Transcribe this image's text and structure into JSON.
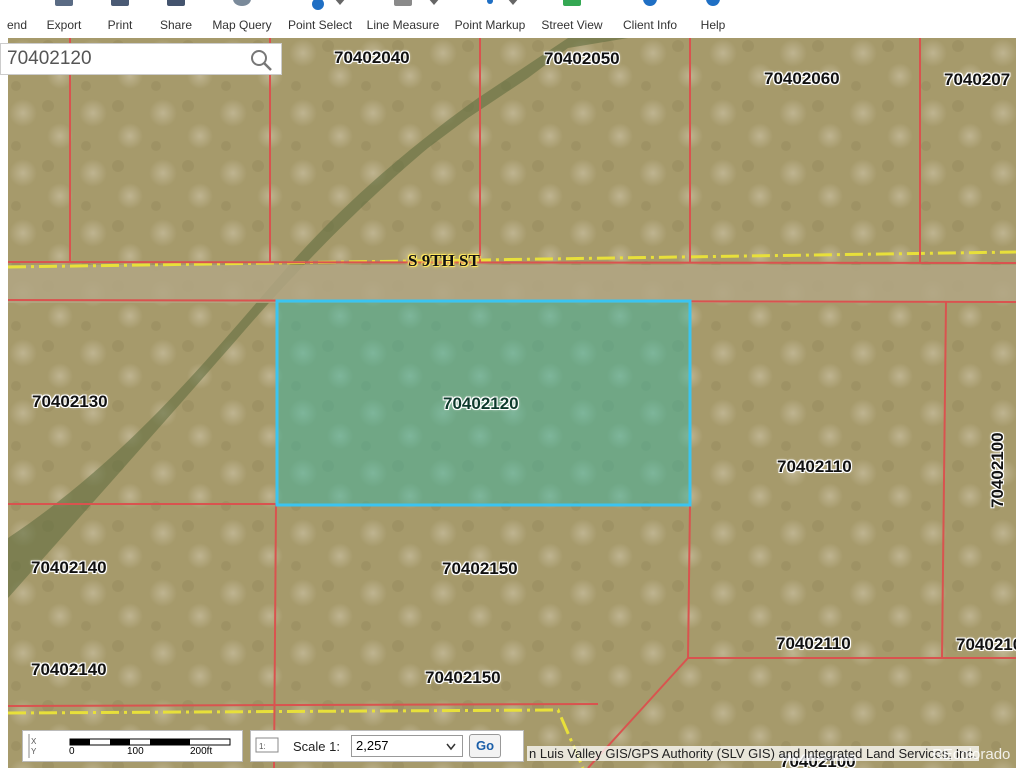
{
  "toolbar": {
    "items": [
      {
        "label": "end",
        "icon": "legend-icon"
      },
      {
        "label": "Export",
        "icon": "export-icon"
      },
      {
        "label": "Print",
        "icon": "print-icon"
      },
      {
        "label": "Share",
        "icon": "share-icon"
      },
      {
        "label": "Map Query",
        "icon": "map-query-icon"
      },
      {
        "label": "Point Select",
        "icon": "point-select-icon"
      },
      {
        "label": "Line Measure",
        "icon": "line-measure-icon"
      },
      {
        "label": "Point Markup",
        "icon": "point-markup-icon"
      },
      {
        "label": "Street View",
        "icon": "street-view-icon"
      },
      {
        "label": "Client Info",
        "icon": "client-info-icon"
      },
      {
        "label": "Help",
        "icon": "help-icon"
      }
    ]
  },
  "search": {
    "value": "70402120"
  },
  "map": {
    "street_label": "S 9TH ST",
    "selected_parcel": "70402120",
    "parcels": [
      "70402040",
      "70402050",
      "70402060",
      "7040207",
      "70402130",
      "70402120",
      "70402110",
      "70402100",
      "70402140",
      "70402150",
      "70402110",
      "70402140",
      "70402150",
      "7040210",
      "70402100"
    ],
    "colors": {
      "parcel_line": "#d9534f",
      "selected_outline": "#3bc4f0",
      "selected_fill": "#2fb8a6",
      "road_line": "#e8e03a"
    }
  },
  "scalebar": {
    "ticks": [
      "0",
      "100",
      "200ft"
    ]
  },
  "scale": {
    "label": "Scale 1:",
    "value": "2,257",
    "go": "Go"
  },
  "attribution": "n Luis Valley GIS/GPS Authority (SLV GIS) and Integrated Land Services, Inc.",
  "watermark": "REcolorado"
}
